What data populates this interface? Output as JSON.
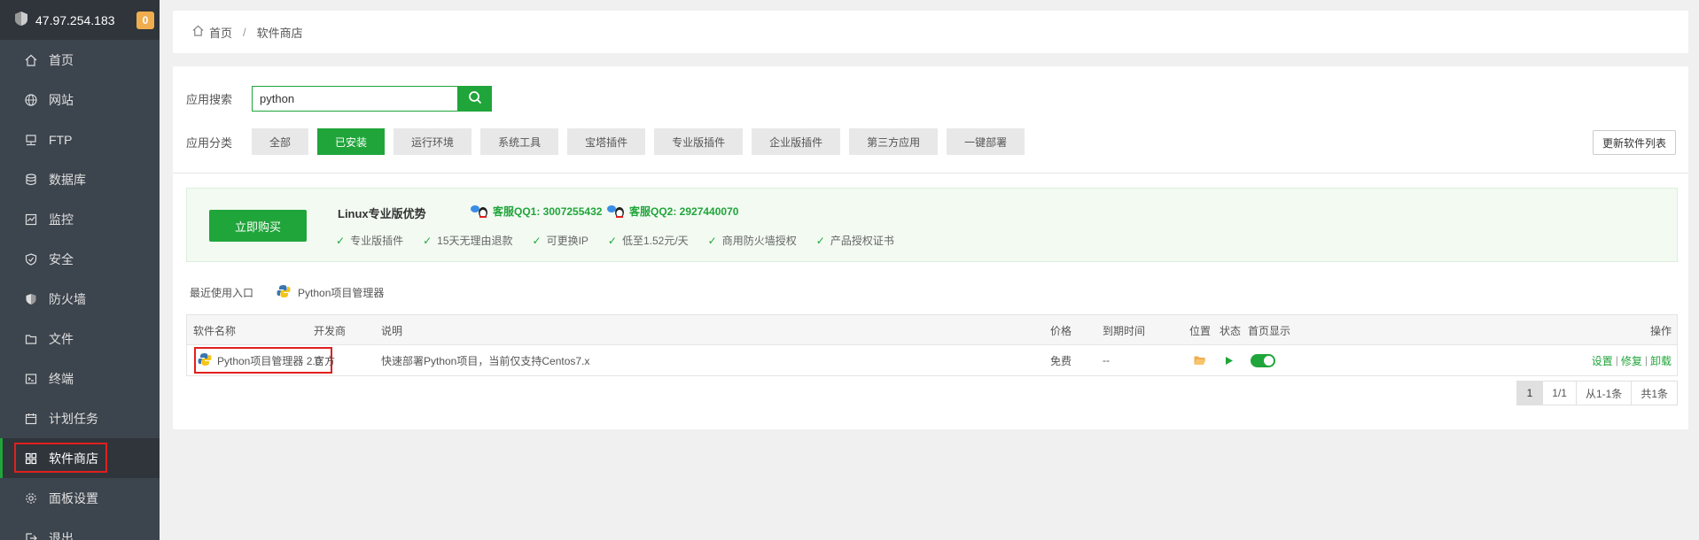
{
  "sidebar": {
    "server_ip": "47.97.254.183",
    "badge_count": "0",
    "items": [
      {
        "label": "首页",
        "icon": "home-icon"
      },
      {
        "label": "网站",
        "icon": "globe-icon"
      },
      {
        "label": "FTP",
        "icon": "ftp-icon"
      },
      {
        "label": "数据库",
        "icon": "database-icon"
      },
      {
        "label": "监控",
        "icon": "monitor-icon"
      },
      {
        "label": "安全",
        "icon": "shield-icon"
      },
      {
        "label": "防火墙",
        "icon": "firewall-icon"
      },
      {
        "label": "文件",
        "icon": "folder-icon"
      },
      {
        "label": "终端",
        "icon": "terminal-icon"
      },
      {
        "label": "计划任务",
        "icon": "calendar-icon"
      },
      {
        "label": "软件商店",
        "icon": "grid-icon",
        "active": true
      },
      {
        "label": "面板设置",
        "icon": "gear-icon"
      },
      {
        "label": "退出",
        "icon": "logout-icon"
      }
    ]
  },
  "breadcrumb": {
    "home": "首页",
    "current": "软件商店"
  },
  "search": {
    "label": "应用搜索",
    "value": "python"
  },
  "categories": {
    "label": "应用分类",
    "items": [
      "全部",
      "已安装",
      "运行环境",
      "系统工具",
      "宝塔插件",
      "专业版插件",
      "企业版插件",
      "第三方应用",
      "一键部署"
    ],
    "selected": "已安装"
  },
  "refresh_label": "更新软件列表",
  "promo": {
    "buy_label": "立即购买",
    "title": "Linux专业版优势",
    "qq1": "客服QQ1: 3007255432",
    "qq2": "客服QQ2: 2927440070",
    "features": [
      "专业版插件",
      "15天无理由退款",
      "可更换IP",
      "低至1.52元/天",
      "商用防火墙授权",
      "产品授权证书"
    ]
  },
  "recent": {
    "label": "最近使用入口",
    "items": [
      "Python项目管理器"
    ]
  },
  "table": {
    "headers": {
      "name": "软件名称",
      "developer": "开发商",
      "description": "说明",
      "price": "价格",
      "expiry": "到期时间",
      "location": "位置",
      "status": "状态",
      "homepage": "首页显示",
      "actions": "操作"
    },
    "rows": [
      {
        "name": "Python项目管理器 2.0",
        "developer": "官方",
        "description": "快速部署Python项目，当前仅支持Centos7.x",
        "price": "免费",
        "expiry": "--",
        "homepage_on": true,
        "actions": [
          "设置",
          "修复",
          "卸载"
        ]
      }
    ]
  },
  "pagination": {
    "current": "1",
    "pages": "1/1",
    "range": "从1-1条",
    "total": "共1条"
  },
  "colors": {
    "accent": "#20a53a",
    "sidebar_bg": "#3c444d",
    "highlight": "#e0201e",
    "badge": "#f0ad4e"
  }
}
